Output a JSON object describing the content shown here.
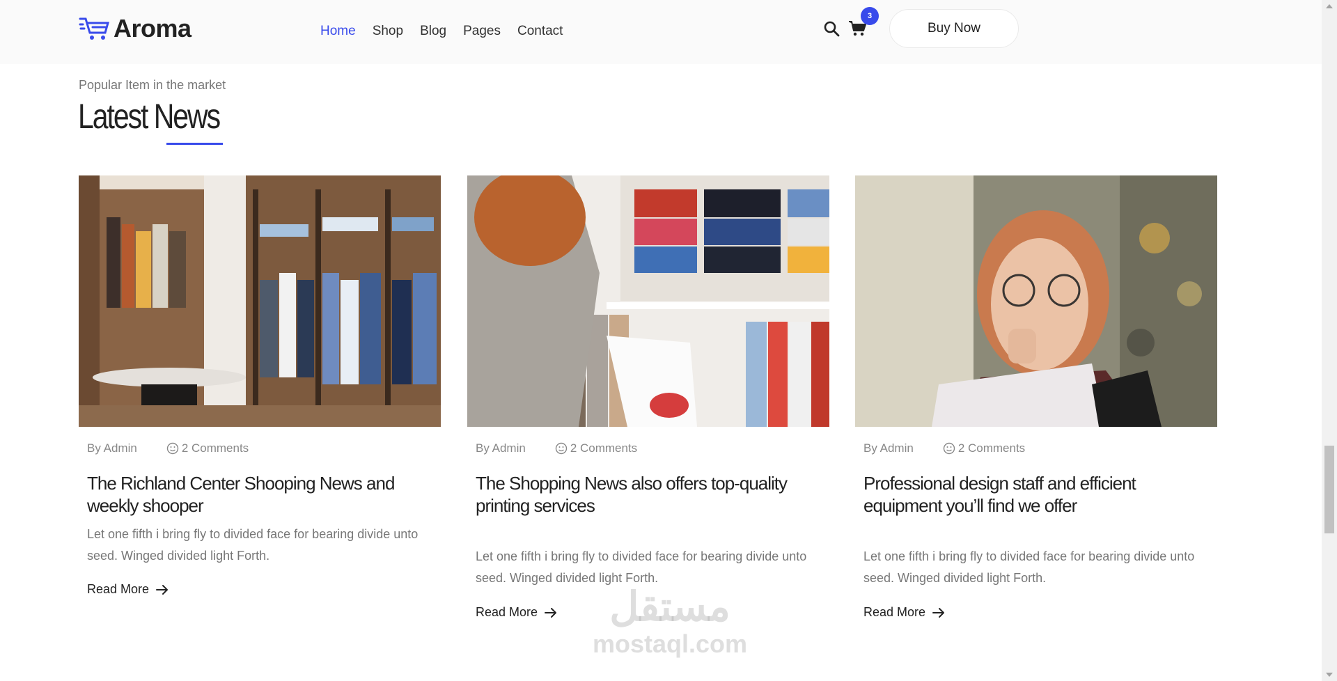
{
  "header": {
    "logo_text": "Aroma",
    "nav": [
      "Home",
      "Shop",
      "Blog",
      "Pages",
      "Contact"
    ],
    "active_nav": "Home",
    "cart_count": "3",
    "buy_button": "Buy Now"
  },
  "section": {
    "subtitle": "Popular Item in the market",
    "title": "Latest News"
  },
  "cards": [
    {
      "author": "By Admin",
      "comments": "2 Comments",
      "title": "The Richland Center Shooping News and weekly shooper",
      "text": "Let one fifth i bring fly to divided face for bearing divide unto seed. Winged divided light Forth.",
      "read_more": "Read More"
    },
    {
      "author": "By Admin",
      "comments": "2 Comments",
      "title": "The Shopping News also offers top-quality printing services",
      "text": "Let one fifth i bring fly to divided face for bearing divide unto seed. Winged divided light Forth.",
      "read_more": "Read More"
    },
    {
      "author": "By Admin",
      "comments": "2 Comments",
      "title": "Professional design staff and efficient equipment you’ll find we offer",
      "text": "Let one fifth i bring fly to divided face for bearing divide unto seed. Winged divided light Forth.",
      "read_more": "Read More"
    }
  ],
  "watermark": {
    "arabic": "مستقل",
    "latin": "mostaql.com"
  },
  "colors": {
    "accent": "#384aeb",
    "text_dark": "#222222",
    "text_muted": "#777777"
  }
}
